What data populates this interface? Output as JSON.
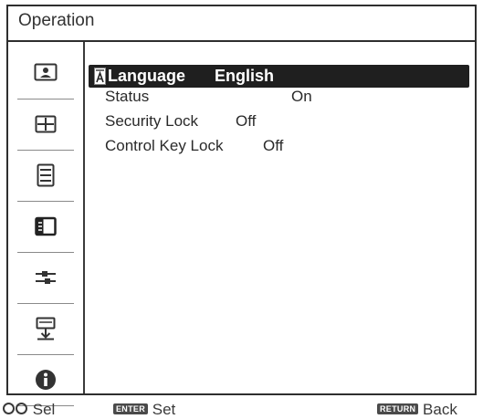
{
  "window": {
    "title": "Operation"
  },
  "sidebar": {
    "items": [
      {
        "icon": "picture-icon"
      },
      {
        "icon": "screen-icon"
      },
      {
        "icon": "setup-icon"
      },
      {
        "icon": "function-icon"
      },
      {
        "icon": "connection-icon"
      },
      {
        "icon": "installation-icon"
      },
      {
        "icon": "information-icon"
      }
    ],
    "selected_index": 3
  },
  "menu": {
    "items": [
      {
        "label": "Language",
        "value": "English",
        "selected": true,
        "icon": "language-icon"
      },
      {
        "label": "Status",
        "value": "On"
      },
      {
        "label": "Security Lock",
        "value": "Off"
      },
      {
        "label": "Control Key Lock",
        "value": "Off"
      }
    ]
  },
  "footer": {
    "select_label": "Sel",
    "enter_key": "ENTER",
    "set_label": "Set",
    "return_key": "RETURN",
    "back_label": "Back"
  }
}
